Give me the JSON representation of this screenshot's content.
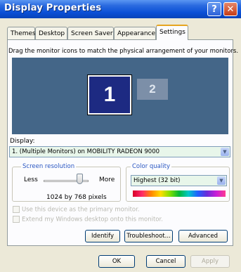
{
  "window": {
    "title": "Display Properties",
    "help_glyph": "?",
    "close_glyph": "✕"
  },
  "tabs": [
    "Themes",
    "Desktop",
    "Screen Saver",
    "Appearance",
    "Settings"
  ],
  "active_tab": "Settings",
  "settings": {
    "instruction": "Drag the monitor icons to match the physical arrangement of your monitors.",
    "monitor_1": "1",
    "monitor_2": "2",
    "display_label": "Display:",
    "display_value": "1. (Multiple Monitors) on MOBILITY RADEON 9000",
    "screen_resolution": {
      "title": "Screen resolution",
      "less": "Less",
      "more": "More",
      "value": "1024 by 768 pixels",
      "slider_position": 0.85
    },
    "color_quality": {
      "title": "Color quality",
      "value": "Highest (32 bit)"
    },
    "checkbox_primary": "Use this device as the primary monitor.",
    "checkbox_extend": "Extend my Windows desktop onto this monitor.",
    "buttons": {
      "identify": "Identify",
      "troubleshoot": "Troubleshoot...",
      "advanced": "Advanced"
    }
  },
  "footer": {
    "ok": "OK",
    "cancel": "Cancel",
    "apply": "Apply"
  },
  "colors": {
    "title_bar": "#0a4fd6",
    "monitor_area": "#446688",
    "monitor_selected": "#1d2a82",
    "monitor_other": "#7c8fa8",
    "group_title": "#2a57c2",
    "select_background": "#e8f6ea"
  }
}
